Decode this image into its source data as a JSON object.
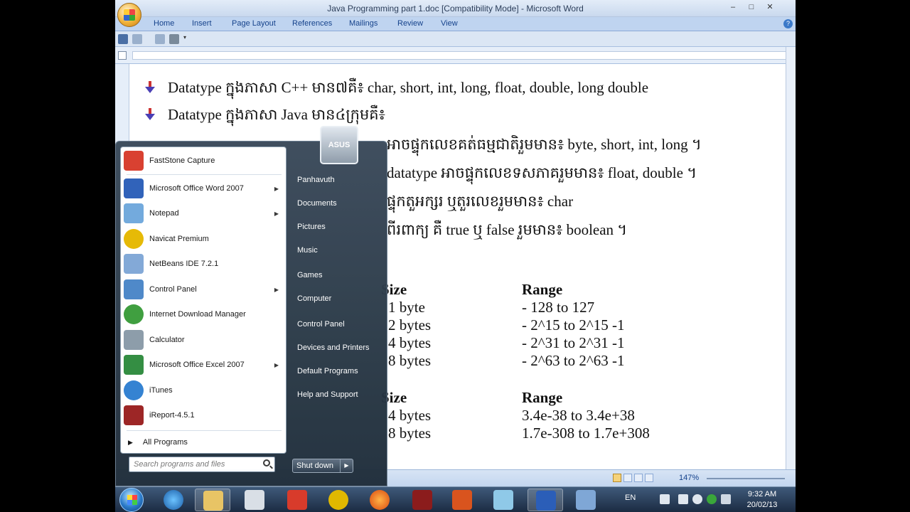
{
  "window": {
    "title": "Java Programming part 1.doc [Compatibility Mode] - Microsoft Word",
    "controls": [
      "–",
      "□",
      "✕"
    ]
  },
  "ribbon": {
    "tabs": [
      "Home",
      "Insert",
      "Page Layout",
      "References",
      "Mailings",
      "Review",
      "View"
    ]
  },
  "document": {
    "line1": "Datatype ក្នុងភាសា C++ មាន៧គឺ៖ char, short, int, long, float, double, long double",
    "line2": "Datatype ក្នុងភាសា Java មាន៤ក្រុមគឺ៖",
    "line3": "អាចផ្ទុកលេខគត់ធម្មជាតិរួមមាន៖ byte, short, int, long ។",
    "line4": "datatype អាចផ្ទុកលេខទសភាគរួមមាន៖ float, double ។",
    "line5": "ផ្ទុកតួអក្សរ ឬតួរលេខរួមមាន៖ char",
    "line6": "ពីរពាក្យ គឺ true ឬ false រួមមាន៖ boolean ។",
    "table1": {
      "size_header": "Size",
      "range_header": "Range",
      "sizes": [
        "1 byte",
        "2 bytes",
        "4 bytes",
        "8 bytes"
      ],
      "ranges": [
        "- 128 to 127",
        "- 2^15 to 2^15 -1",
        "- 2^31 to 2^31 -1",
        "- 2^63 to 2^63 -1"
      ]
    },
    "table2": {
      "size_header": "Size",
      "range_header": "Range",
      "sizes": [
        "4 bytes",
        "8 bytes"
      ],
      "ranges": [
        "3.4e-38 to 3.4e+38",
        "1.7e-308 to 1.7e+308"
      ]
    }
  },
  "statusbar": {
    "zoom": "147%"
  },
  "startmenu": {
    "programs": [
      {
        "label": "FastStone Capture",
        "arrow": false,
        "color": "#d83b2b"
      },
      {
        "label": "Microsoft Office Word 2007",
        "arrow": true,
        "color": "#2b5eb8"
      },
      {
        "label": "Notepad",
        "arrow": true,
        "color": "#6fa8dc"
      },
      {
        "label": "Navicat Premium",
        "arrow": false,
        "color": "#e6b800"
      },
      {
        "label": "NetBeans IDE 7.2.1",
        "arrow": false,
        "color": "#7fa7d6"
      },
      {
        "label": "Control Panel",
        "arrow": true,
        "color": "#4a86c8"
      },
      {
        "label": "Internet Download Manager",
        "arrow": false,
        "color": "#3a9c3a"
      },
      {
        "label": "Calculator",
        "arrow": false,
        "color": "#8a9aa8"
      },
      {
        "label": "Microsoft Office Excel 2007",
        "arrow": true,
        "color": "#2e8b3d"
      },
      {
        "label": "iTunes",
        "arrow": false,
        "color": "#2f7fd1"
      },
      {
        "label": "iReport-4.5.1",
        "arrow": false,
        "color": "#9a2020"
      }
    ],
    "all_programs": "All Programs",
    "search_placeholder": "Search programs and files",
    "user_tile": "ASUS",
    "right_links": [
      "Panhavuth",
      "Documents",
      "Pictures",
      "Music",
      "Games",
      "Computer",
      "Control Panel",
      "Devices and Printers",
      "Default Programs",
      "Help and Support"
    ],
    "shutdown": "Shut down"
  },
  "taskbar": {
    "lang": "EN",
    "time": "9:32 AM",
    "date": "20/02/13"
  }
}
